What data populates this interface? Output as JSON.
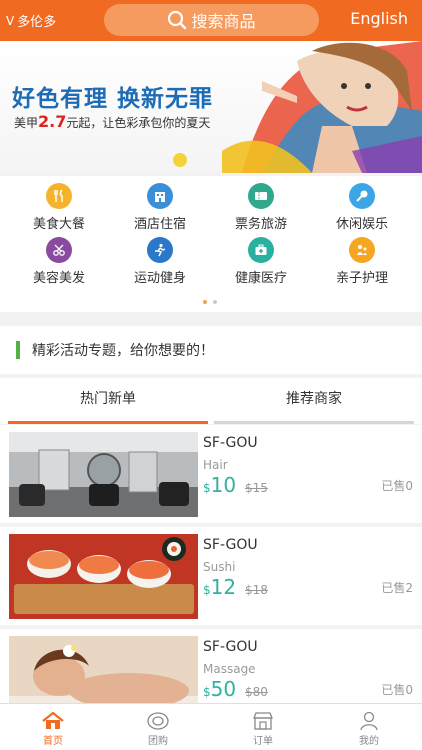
{
  "header": {
    "city": "多伦多",
    "city_chevron": "V",
    "search_placeholder": "搜索商品",
    "language": "English"
  },
  "banner": {
    "title": "好色有理 换新无罪",
    "sub_prefix": "美甲",
    "sub_price": "2.7",
    "sub_suffix": "元起，让色彩承包你的夏天"
  },
  "categories": [
    {
      "label": "美食大餐",
      "icon": "fork-knife-icon",
      "color": "#f5b32c"
    },
    {
      "label": "酒店住宿",
      "icon": "hotel-icon",
      "color": "#3a8fd8"
    },
    {
      "label": "票务旅游",
      "icon": "ticket-icon",
      "color": "#2fa88e"
    },
    {
      "label": "休闲娱乐",
      "icon": "microphone-icon",
      "color": "#3aa6e6"
    },
    {
      "label": "美容美发",
      "icon": "scissors-icon",
      "color": "#8a4aa0"
    },
    {
      "label": "运动健身",
      "icon": "runner-icon",
      "color": "#2b78c8"
    },
    {
      "label": "健康医疗",
      "icon": "medical-kit-icon",
      "color": "#2ab0a0"
    },
    {
      "label": "亲子护理",
      "icon": "family-icon",
      "color": "#f5a623"
    }
  ],
  "activity": {
    "text": "精彩活动专题，给你想要的！"
  },
  "tabs": [
    {
      "label": "热门新单",
      "active": true
    },
    {
      "label": "推荐商家",
      "active": false
    }
  ],
  "items": [
    {
      "name": "SF-GOU",
      "category": "Hair",
      "currency": "$",
      "price": "10",
      "old_price": "$15",
      "sold": "已售0"
    },
    {
      "name": "SF-GOU",
      "category": "Sushi",
      "currency": "$",
      "price": "12",
      "old_price": "$18",
      "sold": "已售2"
    },
    {
      "name": "SF-GOU",
      "category": "Massage",
      "currency": "$",
      "price": "50",
      "old_price": "$80",
      "sold": "已售0"
    }
  ],
  "nav": [
    {
      "label": "首页",
      "icon": "home-icon",
      "active": true
    },
    {
      "label": "团购",
      "icon": "group-buy-icon",
      "active": false
    },
    {
      "label": "订单",
      "icon": "shop-order-icon",
      "active": false
    },
    {
      "label": "我的",
      "icon": "user-icon",
      "active": false
    }
  ],
  "colors": {
    "accent": "#f06a22",
    "price": "#33b0a0",
    "activity_bar": "#57b043"
  }
}
